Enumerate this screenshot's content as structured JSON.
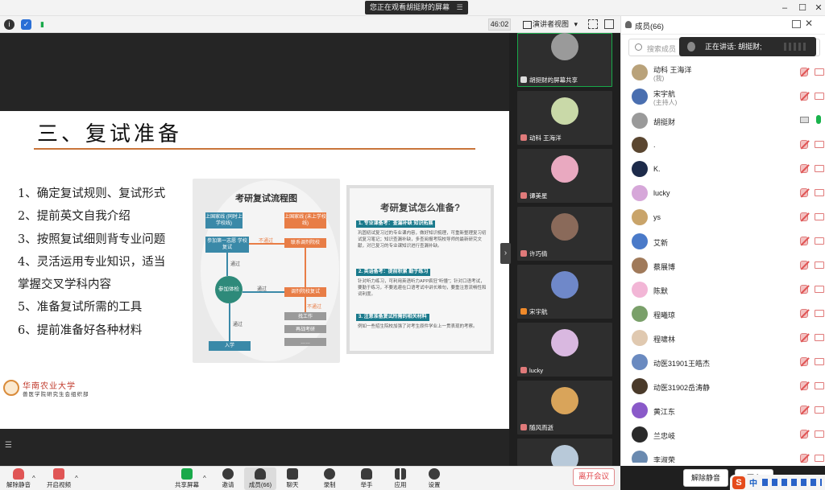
{
  "window": {
    "share_notice": "您正在观看胡挺财的屏幕",
    "share_notice_menu": "☰",
    "minimize": "–",
    "maximize": "☐",
    "close": "✕"
  },
  "meeting_bar": {
    "timer": "46:02",
    "view_mode": "演讲者视图",
    "view_caret": "▾"
  },
  "slide": {
    "title": "三、复试准备",
    "bullets": [
      "1、确定复试规则、复试形式",
      "2、提前英文自我介绍",
      "3、按照复试细则背专业问题",
      "4、灵活运用专业知识，适当",
      "掌握交叉学科内容",
      "5、准备复试所需的工具",
      "6、提前准备好各种材料"
    ],
    "flow_title": "考研复试流程图",
    "flow_boxes": {
      "b1": "上国家线\n(同时上学校线)",
      "b2": "参加第一志愿\n学校复试",
      "b3": "参加体检",
      "b4": "入学",
      "o1": "上国家线\n(未上学校线)",
      "o2": "联系调剂院校",
      "o3": "调剂院校复试",
      "g1": "找工作",
      "g2": "再战考研",
      "g3": "……"
    },
    "flow_labels": {
      "pass1": "通过",
      "pass2": "通过",
      "pass3": "通过",
      "fail1": "不通过",
      "fail2": "不通过"
    },
    "prep_title": "考研复试怎么准备?",
    "prep_sections": [
      {
        "heading": "1. 专业课备考：查漏补缺 知识拓展",
        "text": "巩固初试复习过的专业课内容，做好知识梳理，可重新整理复习初试复习笔记；知识查漏补缺，多查阅报考院校导师的最新研究文献，对已复习的专业课知识进行查漏补缺。"
      },
      {
        "heading": "2. 英语备考：提前积累 勤于练习",
        "text": "针对听力练习，可利用英语听力APP疯狂“听懂”；针对口语考试，要勤于练习，不要逃避在口语考试中讲长难句，要重注意流畅性和词利度。"
      },
      {
        "heading": "3. 注意准备复试所需的相关材料",
        "text": "例如一些招生院校加强了对考生原件学业上一贯表现的考察。"
      }
    ],
    "univ_name": "华南农业大学",
    "univ_sub": "兽医学院研究生会组织部"
  },
  "gallery": [
    {
      "name": "胡挺财的屏幕共享",
      "color": "#9a9a9a"
    },
    {
      "name": "动科 王海洋",
      "color": "#c9d9a8"
    },
    {
      "name": "谭美星",
      "color": "#e9a9c0"
    },
    {
      "name": "许巧倩",
      "color": "#8a6a5a"
    },
    {
      "name": "宋宇航",
      "color": "#6f88c9"
    },
    {
      "name": "lucky",
      "color": "#d9b8e0"
    },
    {
      "name": "随风而逝",
      "color": "#d9a45a"
    },
    {
      "name": "",
      "color": "#b8c9d9"
    }
  ],
  "panel": {
    "title": "成员(66)",
    "search_placeholder": "搜索成员",
    "speaking": "正在讲话: 胡挺财;",
    "members": [
      {
        "name": "动科 王海洋",
        "role": "(我)",
        "color": "#b9a27a",
        "state": "muted"
      },
      {
        "name": "宋宇航",
        "role": "(主持人)",
        "color": "#4a6fb0",
        "state": "muted"
      },
      {
        "name": "胡挺财",
        "role": "",
        "color": "#9a9a9a",
        "state": "on"
      },
      {
        "name": ".",
        "role": "",
        "color": "#5a4630",
        "state": "muted"
      },
      {
        "name": "K.",
        "role": "",
        "color": "#1d2b4a",
        "state": "muted"
      },
      {
        "name": "lucky",
        "role": "",
        "color": "#d6a7d9",
        "state": "muted"
      },
      {
        "name": "ys",
        "role": "",
        "color": "#c9a46a",
        "state": "muted"
      },
      {
        "name": "艾新",
        "role": "",
        "color": "#4a7ac9",
        "state": "muted"
      },
      {
        "name": "蔡展博",
        "role": "",
        "color": "#a07a5a",
        "state": "muted"
      },
      {
        "name": "陈默",
        "role": "",
        "color": "#f2b6d6",
        "state": "muted"
      },
      {
        "name": "程曦琼",
        "role": "",
        "color": "#7aa06a",
        "state": "muted"
      },
      {
        "name": "程啸林",
        "role": "",
        "color": "#e0c9b0",
        "state": "muted"
      },
      {
        "name": "动医31901王皓杰",
        "role": "",
        "color": "#6a8ac0",
        "state": "muted"
      },
      {
        "name": "动医31902岳涛静",
        "role": "",
        "color": "#4a3a2a",
        "state": "muted"
      },
      {
        "name": "黄江东",
        "role": "",
        "color": "#8a5ac9",
        "state": "muted"
      },
      {
        "name": "兰忠岐",
        "role": "",
        "color": "#2a2a2a",
        "state": "muted"
      },
      {
        "name": "李淑荣",
        "role": "",
        "color": "#6a8ab0",
        "state": "muted"
      }
    ],
    "unmute_all": "解除静音",
    "more": "更多"
  },
  "toolbar": {
    "unmute": "解除静音",
    "start_video": "开启视频",
    "share_screen": "共享屏幕",
    "invite": "邀请",
    "members": "成员(66)",
    "chat": "聊天",
    "record": "录制",
    "raise_hand": "举手",
    "apps": "应用",
    "settings": "设置",
    "leave": "离开会议"
  },
  "ime": {
    "logo": "S",
    "lang": "中"
  }
}
